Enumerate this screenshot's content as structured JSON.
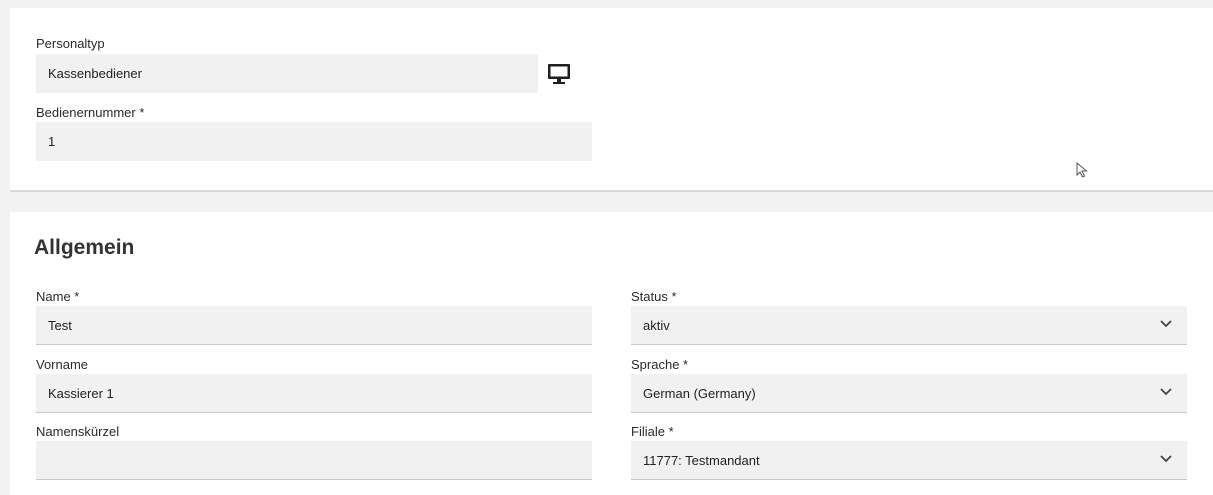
{
  "header": {
    "personaltyp": {
      "label": "Personaltyp",
      "value": "Kassenbediener"
    },
    "bedienernummer": {
      "label": "Bedienernummer *",
      "value": "1"
    }
  },
  "allgemein": {
    "title": "Allgemein",
    "name": {
      "label": "Name *",
      "value": "Test"
    },
    "vorname": {
      "label": "Vorname",
      "value": "Kassierer 1"
    },
    "namenskuerzel": {
      "label": "Namenskürzel",
      "value": ""
    },
    "status": {
      "label": "Status *",
      "value": "aktiv"
    },
    "sprache": {
      "label": "Sprache *",
      "value": "German (Germany)"
    },
    "filiale": {
      "label": "Filiale *",
      "value": "11777: Testmandant"
    }
  },
  "icons": {
    "monitor": "monitor-icon",
    "chevron": "chevron-down-icon",
    "cursor": "mouse-cursor-icon"
  }
}
